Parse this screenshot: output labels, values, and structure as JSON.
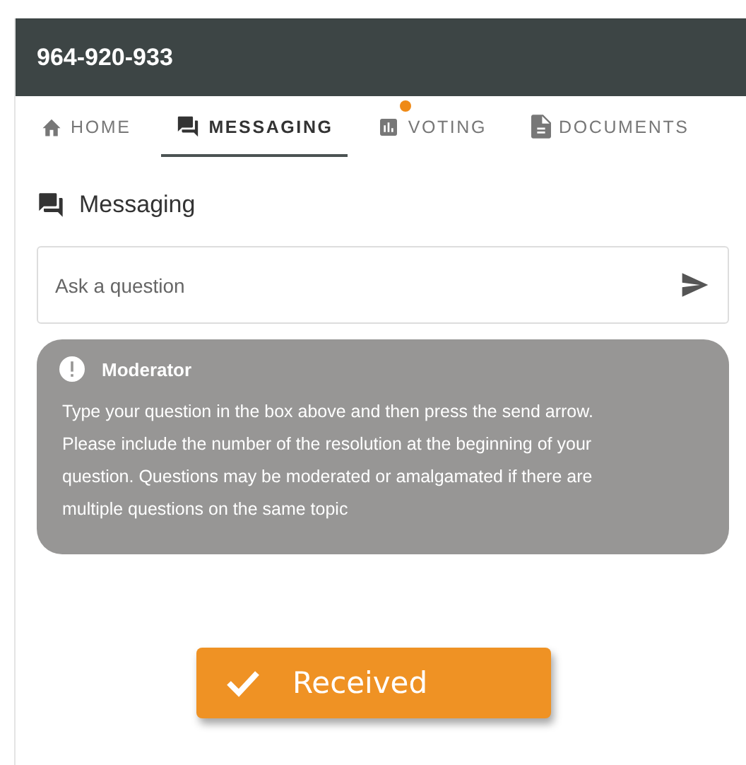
{
  "header": {
    "title": "964-920-933"
  },
  "tabs": [
    {
      "label": "HOME",
      "kind": "home",
      "selected": false,
      "badge": false
    },
    {
      "label": "MESSAGING",
      "kind": "chat",
      "selected": true,
      "badge": false
    },
    {
      "label": "VOTING",
      "kind": "chart",
      "selected": false,
      "badge": true
    },
    {
      "label": "DOCUMENTS",
      "kind": "doc",
      "selected": false,
      "badge": false
    }
  ],
  "section": {
    "title": "Messaging"
  },
  "question": {
    "placeholder": "Ask a question"
  },
  "notice": {
    "title": "Moderator",
    "text": "Type your question in the box above and then press the send arrow. Please include the number of the resolution at the beginning of your question. Questions may be moderated or amalgamated if there are multiple questions on the same topic"
  },
  "toast": {
    "text": "Received"
  }
}
